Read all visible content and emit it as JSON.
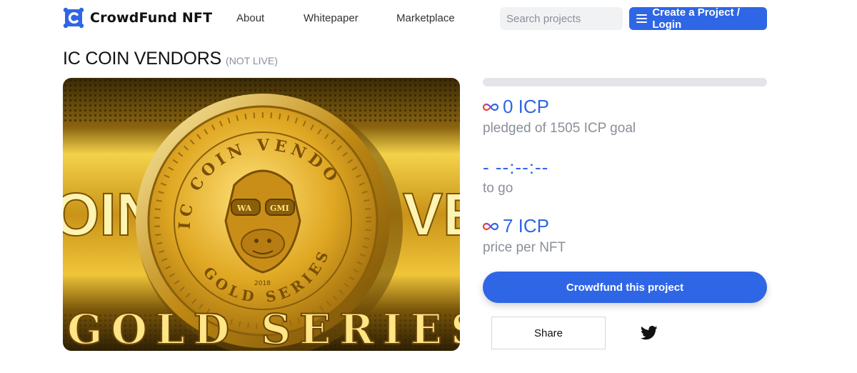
{
  "header": {
    "brand": "CrowdFund NFT",
    "nav": [
      {
        "label": "About"
      },
      {
        "label": "Whitepaper"
      },
      {
        "label": "Marketplace"
      }
    ],
    "search": {
      "placeholder": "Search projects",
      "value": ""
    },
    "cta_label": "Create a Project / Login"
  },
  "project": {
    "title": "IC COIN VENDORS",
    "status": "(NOT LIVE)",
    "image": {
      "banner_left_text": "OIN",
      "banner_right_text": "VE",
      "bottom_text": "GOLD SERIES",
      "coin_top_text": "IC COIN VENDORS",
      "coin_bottom_text": "GOLD SERIES",
      "glasses_left": "WA",
      "glasses_right": "GMI",
      "year": "2018"
    }
  },
  "funding": {
    "progress_fraction": 0,
    "pledged_value": "0 ICP",
    "pledged_label": "pledged of 1505 ICP goal",
    "countdown": "- --:--:--",
    "countdown_label": "to go",
    "price_value": "7 ICP",
    "price_label": "price per NFT",
    "crowdfund_label": "Crowdfund this project",
    "share_label": "Share"
  },
  "colors": {
    "accent": "#2f66e6",
    "muted_text": "#8a8f98",
    "gold": "#d4a017"
  },
  "icons": {
    "logo": "crowdfund-logo-icon",
    "menu": "hamburger-menu-icon",
    "currency": "icp-infinity-icon",
    "social": "twitter-icon"
  }
}
